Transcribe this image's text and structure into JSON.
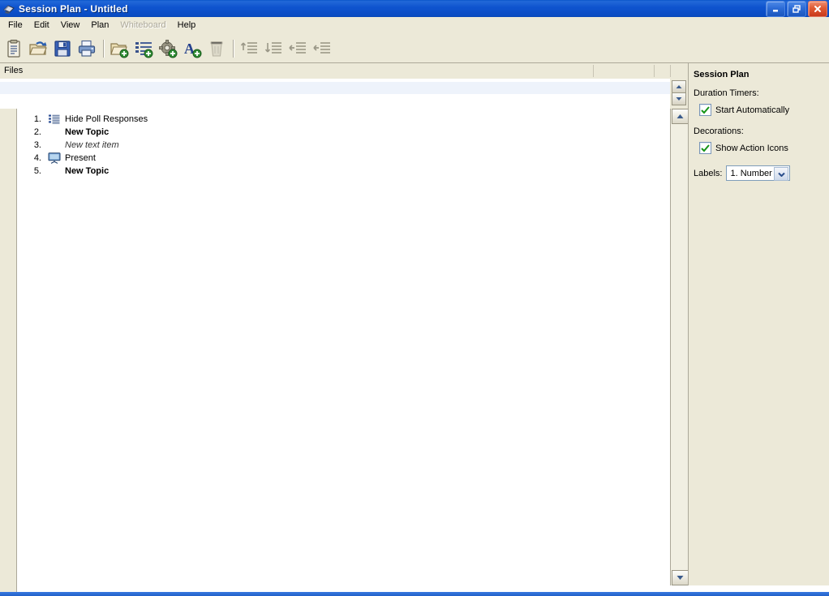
{
  "window": {
    "title": "Session Plan - Untitled",
    "app_icon": "session-plan-icon",
    "controls": {
      "minimize": "Minimize",
      "restore": "Restore",
      "close": "Close"
    }
  },
  "menubar": {
    "items": [
      {
        "label": "File",
        "disabled": false
      },
      {
        "label": "Edit",
        "disabled": false
      },
      {
        "label": "View",
        "disabled": false
      },
      {
        "label": "Plan",
        "disabled": false
      },
      {
        "label": "Whiteboard",
        "disabled": true
      },
      {
        "label": "Help",
        "disabled": false
      }
    ]
  },
  "toolbar": {
    "groups": [
      {
        "buttons": [
          {
            "name": "new-plan-button",
            "icon": "clipboard-new-icon",
            "enabled": true
          },
          {
            "name": "open-plan-button",
            "icon": "folder-open-icon",
            "enabled": true
          },
          {
            "name": "save-plan-button",
            "icon": "floppy-save-icon",
            "enabled": true
          },
          {
            "name": "print-plan-button",
            "icon": "printer-icon",
            "enabled": true
          }
        ]
      },
      {
        "buttons": [
          {
            "name": "add-topic-button",
            "icon": "folder-add-icon",
            "enabled": true
          },
          {
            "name": "add-poll-button",
            "icon": "list-add-icon",
            "enabled": true
          },
          {
            "name": "add-action-button",
            "icon": "gear-add-icon",
            "enabled": true
          },
          {
            "name": "add-text-button",
            "icon": "text-add-icon",
            "enabled": true
          },
          {
            "name": "delete-item-button",
            "icon": "trash-icon",
            "enabled": false
          }
        ]
      },
      {
        "buttons": [
          {
            "name": "move-up-button",
            "icon": "move-up-icon",
            "enabled": false
          },
          {
            "name": "move-down-button",
            "icon": "move-down-icon",
            "enabled": false
          },
          {
            "name": "outdent-button",
            "icon": "outdent-icon",
            "enabled": false
          },
          {
            "name": "indent-button",
            "icon": "indent-icon",
            "enabled": false
          }
        ]
      }
    ]
  },
  "files_pane": {
    "header_label": "Files",
    "column_dividers": [
      731,
      806
    ],
    "rows": []
  },
  "plan": {
    "items": [
      {
        "number": "1.",
        "label": "Hide Poll Responses",
        "icon": "poll-list-icon",
        "style": "normal"
      },
      {
        "number": "2.",
        "label": "New Topic",
        "icon": "none",
        "style": "bold"
      },
      {
        "number": "3.",
        "label": "New text item",
        "icon": "none",
        "style": "italic"
      },
      {
        "number": "4.",
        "label": "Present",
        "icon": "presentation-screen-icon",
        "style": "normal"
      },
      {
        "number": "5.",
        "label": "New Topic",
        "icon": "none",
        "style": "bold"
      }
    ]
  },
  "sidepanel": {
    "title": "Session Plan",
    "duration_section_label": "Duration Timers:",
    "start_automatically": {
      "label": "Start Automatically",
      "checked": true
    },
    "decorations_section_label": "Decorations:",
    "show_action_icons": {
      "label": "Show Action Icons",
      "checked": true
    },
    "labels_field_label": "Labels:",
    "labels_value": "1. Number"
  },
  "colors": {
    "titlebar_blue": "#0a55c8",
    "panel_beige": "#ece9d8",
    "border_grey": "#aca899",
    "list_white": "#ffffff",
    "check_green": "#159415",
    "files_row_blue": "#eef3fb"
  }
}
